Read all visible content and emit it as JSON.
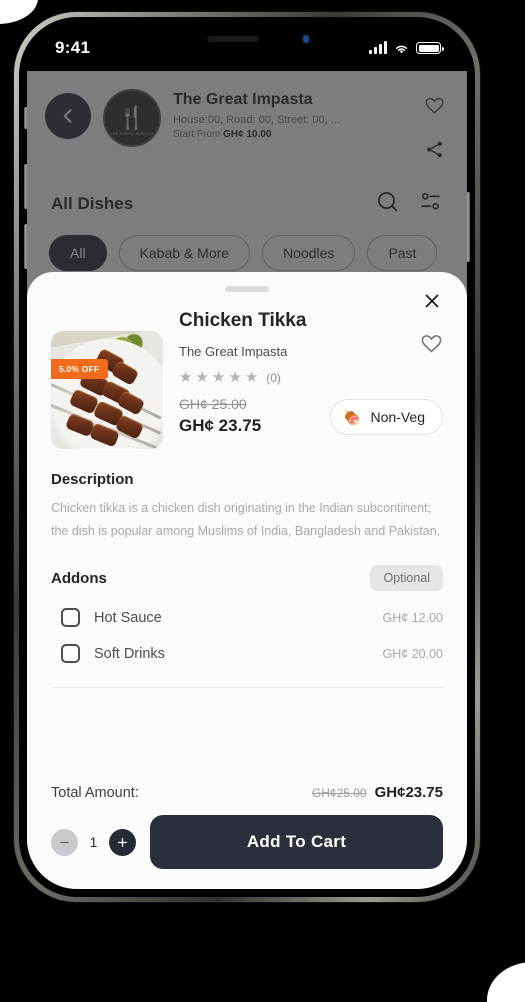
{
  "status_bar": {
    "time": "9:41",
    "signal_icon": "cellular-signal-icon",
    "wifi_icon": "wifi-icon",
    "battery_icon": "battery-icon"
  },
  "restaurant_header": {
    "back_icon": "chevron-left-icon",
    "logo_emblem": "fork-emblem-icon",
    "logo_text": "THE GREAT IMPASTA",
    "name": "The Great Impasta",
    "address": "House:00, Road: 00, Street: 00, ...",
    "start_from_label": "Start From",
    "start_from_price": "GH¢ 10.00",
    "favorite_icon": "heart-outline-icon",
    "share_icon": "share-icon"
  },
  "dishes_bar": {
    "title": "All Dishes",
    "search_icon": "search-icon",
    "filter_icon": "filter-sliders-icon"
  },
  "categories": [
    {
      "label": "All",
      "active": true
    },
    {
      "label": "Kabab & More",
      "active": false
    },
    {
      "label": "Noodles",
      "active": false
    },
    {
      "label": "Past",
      "active": false
    }
  ],
  "sheet": {
    "drag_handle": "drag-handle",
    "close_icon": "close-x-icon",
    "dish": {
      "title": "Chicken Tikka",
      "restaurant": "The Great Impasta",
      "discount_badge": "5.0% OFF",
      "rating_stars": 5,
      "rating_count": "(0)",
      "price_old": "GH¢ 25.00",
      "price_new": "GH¢ 23.75",
      "favorite_icon": "heart-outline-icon",
      "diet_label": "Non-Veg",
      "diet_icon": "meat-on-bone-icon"
    },
    "description": {
      "heading": "Description",
      "text": "Chicken tikka is a chicken dish originating in the Indian subcontinent; the dish is popular among Muslims of India, Bangladesh and Pakistan."
    },
    "addons": {
      "heading": "Addons",
      "optional_badge": "Optional",
      "items": [
        {
          "name": "Hot Sauce",
          "price": "GH¢ 12.00",
          "checked": false
        },
        {
          "name": "Soft Drinks",
          "price": "GH¢ 20.00",
          "checked": false
        }
      ]
    },
    "footer": {
      "total_label": "Total Amount:",
      "total_old": "GH¢25.00",
      "total_new": "GH¢23.75",
      "quantity": "1",
      "minus_icon": "minus-icon",
      "plus_icon": "plus-icon",
      "add_to_cart_label": "Add To Cart"
    }
  },
  "colors": {
    "accent_dark": "#2b2f3c",
    "discount_orange": "#f26a1b",
    "sheet_bg": "#fbfbfb",
    "muted_text": "#a7a9ad"
  }
}
